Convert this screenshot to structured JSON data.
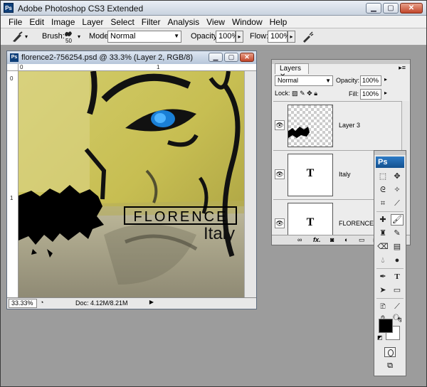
{
  "app": {
    "icon": "Ps",
    "title": "Adobe Photoshop CS3 Extended",
    "window_controls": [
      "minimize",
      "maximize",
      "close"
    ]
  },
  "menu": [
    "File",
    "Edit",
    "Image",
    "Layer",
    "Select",
    "Filter",
    "Analysis",
    "View",
    "Window",
    "Help"
  ],
  "options": {
    "brush_label": "Brush:",
    "brush_size": "50",
    "mode_label": "Mode:",
    "mode_value": "Normal",
    "opacity_label": "Opacity:",
    "opacity_value": "100%",
    "flow_label": "Flow:",
    "flow_value": "100%"
  },
  "document": {
    "title": "florence2-756254.psd @ 33.3% (Layer 2, RGB/8)",
    "ruler_h": [
      "0",
      "1"
    ],
    "ruler_v": [
      "0",
      "1"
    ],
    "zoom": "33.33%",
    "doc_info": "Doc: 4.12M/8.21M",
    "canvas": {
      "text_line1": "FLORENCE",
      "text_line2": "Italy"
    }
  },
  "layers_panel": {
    "tab": "Layers",
    "blend_mode": "Normal",
    "opacity_label": "Opacity:",
    "opacity_value": "100%",
    "lock_label": "Lock:",
    "fill_label": "Fill:",
    "fill_value": "100%",
    "layers": [
      {
        "name": "Layer 3",
        "thumb_type": "transparent"
      },
      {
        "name": "Italy",
        "thumb_type": "text",
        "thumb_glyph": "T"
      },
      {
        "name": "FLORENCE",
        "thumb_type": "text",
        "thumb_glyph": "T"
      }
    ]
  },
  "tools_panel": {
    "logo": "Ps",
    "foreground_color": "#000000",
    "background_color": "#ffffff",
    "type_tool_glyph": "T"
  }
}
